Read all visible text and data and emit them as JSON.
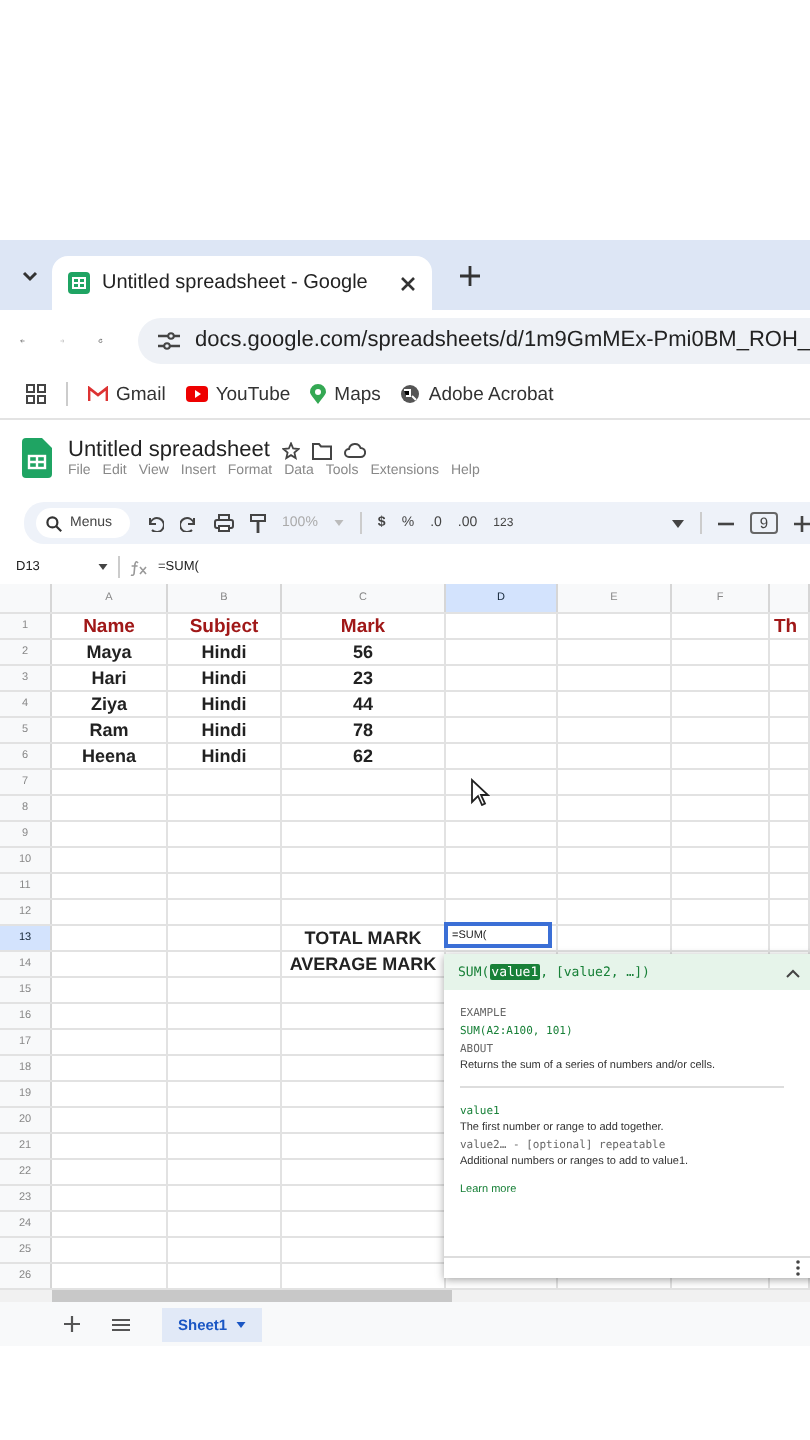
{
  "browser": {
    "tabs": [
      {
        "title": "Untitled spreadsheet - Google",
        "selected": true
      }
    ],
    "url": "docs.google.com/spreadsheets/d/1m9GmMEx-Pmi0BM_ROH_",
    "bookmarks": [
      "Gmail",
      "YouTube",
      "Maps",
      "Adobe Acrobat"
    ]
  },
  "document": {
    "title": "Untitled spreadsheet",
    "menu": [
      "File",
      "Edit",
      "View",
      "Insert",
      "Format",
      "Data",
      "Tools",
      "Extensions",
      "Help"
    ]
  },
  "toolbar": {
    "search": "Menus",
    "zoom": "100%",
    "currency": "$",
    "percent": "%",
    "decrease_decimal": ".0",
    "increase_decimal": ".00",
    "number_format": "123",
    "font_size": "9"
  },
  "formula_bar": {
    "cell": "D13",
    "formula": "=SUM("
  },
  "columns": [
    {
      "label": "A",
      "selected": false
    },
    {
      "label": "B",
      "selected": false
    },
    {
      "label": "C",
      "selected": false
    },
    {
      "label": "D",
      "selected": true
    },
    {
      "label": "E",
      "selected": false
    },
    {
      "label": "F",
      "selected": false
    }
  ],
  "rows": [
    {
      "number": "1",
      "selected": false,
      "kind": "header",
      "col_a": "Name",
      "col_b": "Subject",
      "col_c": "Mark",
      "col_g": "Th"
    },
    {
      "number": "2",
      "selected": false,
      "kind": "data",
      "col_a": "Maya",
      "col_b": "Hindi",
      "col_c": "56"
    },
    {
      "number": "3",
      "selected": false,
      "kind": "data",
      "col_a": "Hari",
      "col_b": "Hindi",
      "col_c": "23"
    },
    {
      "number": "4",
      "selected": false,
      "kind": "data",
      "col_a": "Ziya",
      "col_b": "Hindi",
      "col_c": "44"
    },
    {
      "number": "5",
      "selected": false,
      "kind": "data",
      "col_a": "Ram",
      "col_b": "Hindi",
      "col_c": "78"
    },
    {
      "number": "6",
      "selected": false,
      "kind": "data",
      "col_a": "Heena",
      "col_b": "Hindi",
      "col_c": "62"
    },
    {
      "number": "7",
      "selected": false
    },
    {
      "number": "8",
      "selected": false
    },
    {
      "number": "9",
      "selected": false
    },
    {
      "number": "10",
      "selected": false
    },
    {
      "number": "11",
      "selected": false
    },
    {
      "number": "12",
      "selected": false
    },
    {
      "number": "13",
      "selected": true,
      "kind": "summary",
      "col_c": "TOTAL MARK",
      "col_d": "=SUM("
    },
    {
      "number": "14",
      "selected": false,
      "kind": "summary",
      "col_c": "AVERAGE MARK"
    },
    {
      "number": "15",
      "selected": false
    },
    {
      "number": "16",
      "selected": false
    },
    {
      "number": "17",
      "selected": false
    },
    {
      "number": "18",
      "selected": false
    },
    {
      "number": "19",
      "selected": false
    },
    {
      "number": "20",
      "selected": false
    },
    {
      "number": "21",
      "selected": false
    },
    {
      "number": "22",
      "selected": false
    },
    {
      "number": "23",
      "selected": false
    },
    {
      "number": "24",
      "selected": false
    },
    {
      "number": "25",
      "selected": false
    },
    {
      "number": "26",
      "selected": false
    }
  ],
  "formula_help": {
    "function": "SUM(",
    "current_argument": "value1",
    "rest": ", [value2, …])",
    "example_heading": "EXAMPLE",
    "example": "SUM(A2:A100, 101)",
    "about_heading": "ABOUT",
    "about": "Returns the sum of a series of numbers and/or cells.",
    "arguments": [
      {
        "name": "value1",
        "description": "The first number or range to add together."
      },
      {
        "name": "value2… - [optional] repeatable",
        "description": "Additional numbers or ranges to add to value1."
      }
    ],
    "link": "Learn more"
  },
  "sheets": [
    {
      "name": "Sheet1",
      "selected": true
    }
  ]
}
